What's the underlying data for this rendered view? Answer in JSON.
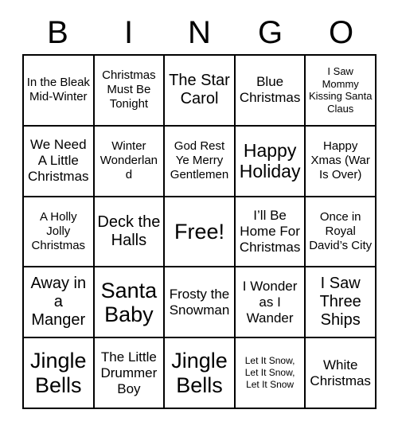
{
  "header": {
    "letters": [
      "B",
      "I",
      "N",
      "G",
      "O"
    ]
  },
  "colors": {
    "grid_line": "#000000",
    "text": "#000000",
    "background": "#ffffff"
  },
  "grid": {
    "rows": 5,
    "columns": 5,
    "cells": [
      {
        "text": "In the Bleak Mid-Winter",
        "size": "sm"
      },
      {
        "text": "Christmas Must Be Tonight",
        "size": "sm"
      },
      {
        "text": "The Star Carol",
        "size": "lg"
      },
      {
        "text": "Blue Christmas",
        "size": "md"
      },
      {
        "text": "I Saw Mommy Kissing Santa Claus",
        "size": "xs"
      },
      {
        "text": "We Need A Little Christmas",
        "size": "md"
      },
      {
        "text": "Winter Wonderland",
        "size": "sm"
      },
      {
        "text": "God Rest Ye Merry Gentlemen",
        "size": "sm"
      },
      {
        "text": "Happy Holiday",
        "size": "xl"
      },
      {
        "text": "Happy Xmas (War Is Over)",
        "size": "sm"
      },
      {
        "text": "A Holly Jolly Christmas",
        "size": "sm"
      },
      {
        "text": "Deck the Halls",
        "size": "lg"
      },
      {
        "text": "Free!",
        "size": "xxl"
      },
      {
        "text": "I’ll Be Home For Christmas",
        "size": "md"
      },
      {
        "text": "Once in Royal David’s City",
        "size": "sm"
      },
      {
        "text": "Away in a Manger",
        "size": "lg"
      },
      {
        "text": "Santa Baby",
        "size": "xxl"
      },
      {
        "text": "Frosty the Snowman",
        "size": "md"
      },
      {
        "text": "I Wonder as I Wander",
        "size": "md"
      },
      {
        "text": "I Saw Three Ships",
        "size": "lg"
      },
      {
        "text": "Jingle Bells",
        "size": "xxl"
      },
      {
        "text": "The Little Drummer Boy",
        "size": "md"
      },
      {
        "text": "Jingle Bells",
        "size": "xxl"
      },
      {
        "text": "Let It Snow, Let It Snow, Let It Snow",
        "size": "xxs"
      },
      {
        "text": "White Christmas",
        "size": "md"
      }
    ]
  }
}
